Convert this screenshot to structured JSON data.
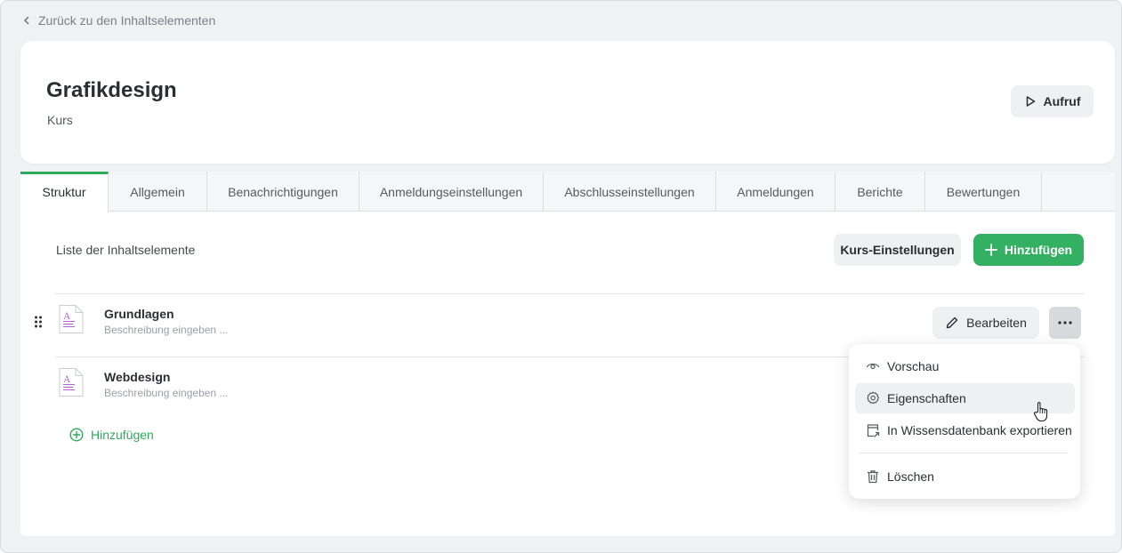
{
  "nav": {
    "back_label": "Zurück zu den Inhaltselementen"
  },
  "course": {
    "title": "Grafikdesign",
    "subtitle": "Kurs",
    "call_button": "Aufruf"
  },
  "tabs": [
    {
      "label": "Struktur",
      "active": true
    },
    {
      "label": "Allgemein"
    },
    {
      "label": "Benachrichtigungen"
    },
    {
      "label": "Anmeldungseinstellungen"
    },
    {
      "label": "Abschlusseinstellungen"
    },
    {
      "label": "Anmeldungen"
    },
    {
      "label": "Berichte"
    },
    {
      "label": "Bewertungen"
    }
  ],
  "list": {
    "title": "Liste der Inhaltselemente",
    "settings_button": "Kurs-Einstellungen",
    "add_button": "Hinzufügen",
    "items": [
      {
        "title": "Grundlagen",
        "description": "Beschreibung eingeben ...",
        "edit_label": "Bearbeiten"
      },
      {
        "title": "Webdesign",
        "description": "Beschreibung eingeben ..."
      }
    ],
    "inline_add": "Hinzufügen"
  },
  "menu": {
    "items": [
      {
        "label": "Vorschau",
        "icon": "eye-icon"
      },
      {
        "label": "Eigenschaften",
        "icon": "gear-icon"
      },
      {
        "label": "In Wissensdatenbank exportieren",
        "icon": "export-icon"
      },
      {
        "label": "Löschen",
        "icon": "trash-icon"
      }
    ]
  },
  "colors": {
    "accent": "#34b062",
    "background": "#eff1f3",
    "doc_icon": "#b35fd6"
  }
}
